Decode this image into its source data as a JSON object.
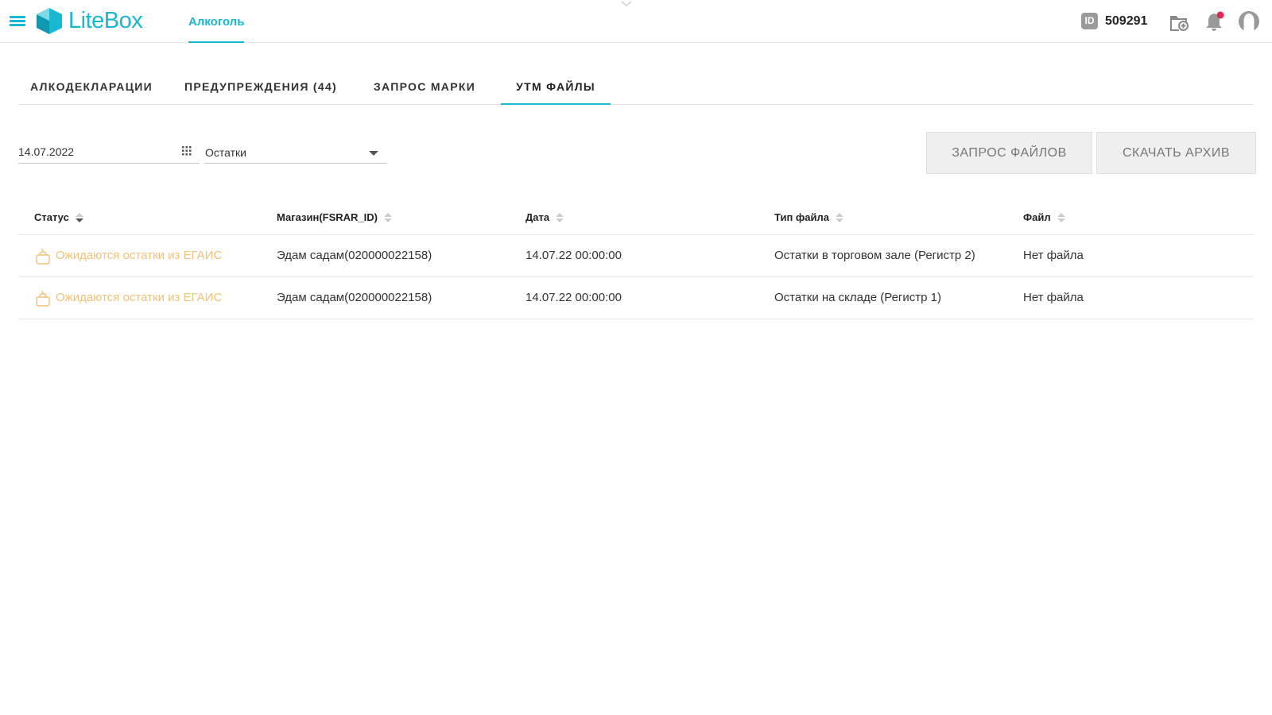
{
  "header": {
    "logo_text": "LiteBox",
    "nav_item": "Алкоголь",
    "id_badge": "ID",
    "account_id": "509291",
    "brand_color": "#1ab7d0",
    "notification_color": "#e0274f"
  },
  "tabs": [
    {
      "label": "АЛКОДЕКЛАРАЦИИ",
      "active": false
    },
    {
      "label": "ПРЕДУПРЕЖДЕНИЯ (44)",
      "active": false
    },
    {
      "label": "ЗАПРОС МАРКИ",
      "active": false
    },
    {
      "label": "УТМ ФАЙЛЫ",
      "active": true
    }
  ],
  "filters": {
    "date_value": "14.07.2022",
    "select_value": "Остатки"
  },
  "buttons": {
    "request_files": "ЗАПРОС ФАЙЛОВ",
    "download_archive": "СКАЧАТЬ АРХИВ"
  },
  "table": {
    "columns": [
      "Статус",
      "Магазин(FSRAR_ID)",
      "Дата",
      "Тип файла",
      "Файл"
    ],
    "rows": [
      {
        "status": "Ожидаются остатки из ЕГАИС",
        "store": "Эдам садам(020000022158)",
        "date": "14.07.22 00:00:00",
        "file_type": "Остатки в торговом зале (Регистр 2)",
        "file": "Нет файла"
      },
      {
        "status": "Ожидаются остатки из ЕГАИС",
        "store": "Эдам садам(020000022158)",
        "date": "14.07.22 00:00:00",
        "file_type": "Остатки на складе (Регистр 1)",
        "file": "Нет файла"
      }
    ],
    "status_color": "#f0c27a"
  }
}
